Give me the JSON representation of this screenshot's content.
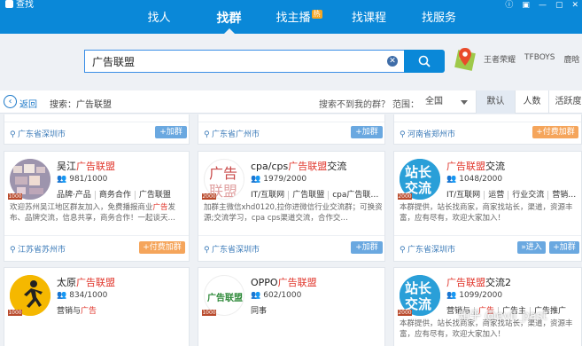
{
  "window": {
    "title": "查找",
    "controls": [
      "ⓘ",
      "▣",
      "—",
      "▢",
      "✕"
    ]
  },
  "nav": {
    "items": [
      {
        "label": "找人",
        "badge": ""
      },
      {
        "label": "找群",
        "badge": ""
      },
      {
        "label": "找主播",
        "badge": "热"
      },
      {
        "label": "找课程",
        "badge": ""
      },
      {
        "label": "找服务",
        "badge": ""
      }
    ],
    "active_index": 1
  },
  "search": {
    "query": "广告联盟",
    "hot_tags": [
      "王者荣耀",
      "TFBOYS",
      "鹿晗"
    ]
  },
  "filter": {
    "back_label": "返回",
    "search_info": "搜索：广告联盟",
    "not_found": "搜索不到我的群？",
    "range_label": "范围：",
    "range_value": "全国",
    "sort_tabs": [
      "默认",
      "人数",
      "活跃度"
    ],
    "sort_active": 0
  },
  "top_row": [
    {
      "location": "广东省深圳市",
      "button": "+加群"
    },
    {
      "location": "广东省广州市",
      "button": "+加群"
    },
    {
      "location": "河南省郑州市",
      "button": "+付费加群"
    }
  ],
  "cards": [
    {
      "name_prefix": "吴江",
      "name_highlight": "广告联盟",
      "name_suffix": "",
      "members": "981/1000",
      "tags": [
        {
          "text": "品牌·产品",
          "hl": false
        },
        {
          "text": "商务合作",
          "hl": false
        },
        {
          "text": "广告联盟",
          "hl": false
        }
      ],
      "desc_html_parts": [
        {
          "text": "欢迎苏州吴江地区群友加入，免费播报商业",
          "hl": false
        },
        {
          "text": "广告",
          "hl": true
        },
        {
          "text": "发布、品牌交流，信息共享，商务合作！一起谈天…",
          "hl": false
        }
      ],
      "location": "江苏省苏州市",
      "buttons": [
        "+付费加群"
      ],
      "level": "1000",
      "avatar": "photo"
    },
    {
      "name_prefix": "cpa/cps",
      "name_highlight": "广告联盟",
      "name_suffix": "交流",
      "members": "1979/2000",
      "tags": [
        {
          "text": "IT/互联网",
          "hl": false
        },
        {
          "text": "广告联盟",
          "hl": false
        },
        {
          "text": "cpa广告联…",
          "hl": false
        }
      ],
      "desc_html_parts": [
        {
          "text": "加群主微信xhd0120,拉你进微信行业交流群；可换资源;交流学习，cpa cps渠道交流，合作交…",
          "hl": false
        }
      ],
      "location": "广东省深圳市",
      "buttons": [
        "+加群"
      ],
      "level": "2000",
      "avatar": "text-ad"
    },
    {
      "name_prefix": "",
      "name_highlight": "广告联盟",
      "name_suffix": "交流",
      "members": "1048/2000",
      "tags": [
        {
          "text": "IT/互联网",
          "hl": false
        },
        {
          "text": "运营",
          "hl": false
        },
        {
          "text": "行业交流",
          "hl": false
        },
        {
          "text": "营销…",
          "hl": false
        }
      ],
      "desc_html_parts": [
        {
          "text": "本群提供，站长找商家，商家找站长，渠道，资源丰富，应有尽有，欢迎大家加入！",
          "hl": false
        }
      ],
      "location": "广东省深圳市",
      "buttons": [
        "»进入",
        "+加群"
      ],
      "level": "2000",
      "avatar": "text-zz"
    },
    {
      "name_prefix": "太原",
      "name_highlight": "广告联盟",
      "name_suffix": "",
      "members": "834/1000",
      "tags": [
        {
          "text": "营销与",
          "hl": false,
          "join": true
        },
        {
          "text": "广告",
          "hl": true,
          "join": true
        }
      ],
      "desc_html_parts": [],
      "location": "",
      "buttons": [],
      "level": "1000",
      "avatar": "runner"
    },
    {
      "name_prefix": "OPPO",
      "name_highlight": "广告联盟",
      "name_suffix": "",
      "members": "602/1000",
      "tags": [
        {
          "text": "同事",
          "hl": false
        }
      ],
      "desc_html_parts": [],
      "location": "",
      "buttons": [],
      "level": "1000",
      "avatar": "text-green"
    },
    {
      "name_prefix": "",
      "name_highlight": "广告联盟",
      "name_suffix": "交流2",
      "members": "1099/2000",
      "tags": [
        {
          "text": "营销与",
          "hl": false,
          "join": true
        },
        {
          "text": "广告",
          "hl": true,
          "join": true
        },
        {
          "text": "广告主",
          "hl": false
        },
        {
          "text": "广告推广",
          "hl": false
        }
      ],
      "desc_html_parts": [
        {
          "text": "本群提供，站长找商家，商家找站长，渠道，资源丰富，应有尽有，欢迎大家加入！",
          "hl": false
        }
      ],
      "location": "",
      "buttons": [],
      "level": "2000",
      "avatar": "text-zz"
    }
  ],
  "avatar_text": {
    "ad": "广告联盟",
    "zz": "站长交流",
    "green": "广告联盟"
  },
  "watermark": "知乎 @evil_past"
}
